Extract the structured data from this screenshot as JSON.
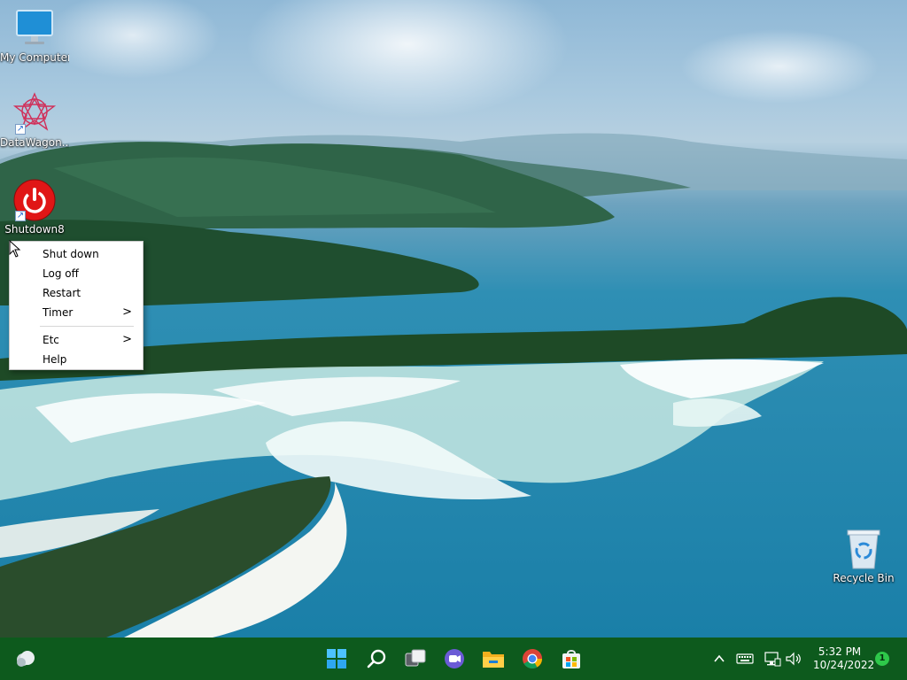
{
  "desktop": {
    "icons": [
      {
        "label": "My Computer"
      },
      {
        "label": "DataWagon..."
      },
      {
        "label": "Shutdown8"
      },
      {
        "label": "Recycle Bin"
      }
    ]
  },
  "context_menu": {
    "items": [
      {
        "label": "Shut down",
        "has_submenu": false
      },
      {
        "label": "Log off",
        "has_submenu": false
      },
      {
        "label": "Restart",
        "has_submenu": false
      },
      {
        "label": "Timer",
        "has_submenu": true
      },
      {
        "label": "Etc",
        "has_submenu": true
      },
      {
        "label": "Help",
        "has_submenu": false
      }
    ],
    "submenu_arrow": ">"
  },
  "taskbar": {
    "color": "#0d5a1d",
    "apps": [
      "widgets-icon",
      "start-icon",
      "search-icon",
      "task-view-icon",
      "chat-icon",
      "file-explorer-icon",
      "chrome-icon",
      "store-icon"
    ],
    "tray": [
      "chevron-up-icon",
      "keyboard-icon",
      "network-icon",
      "volume-icon"
    ],
    "time": "5:32 PM",
    "date": "10/24/2022",
    "notification_count": "1"
  }
}
